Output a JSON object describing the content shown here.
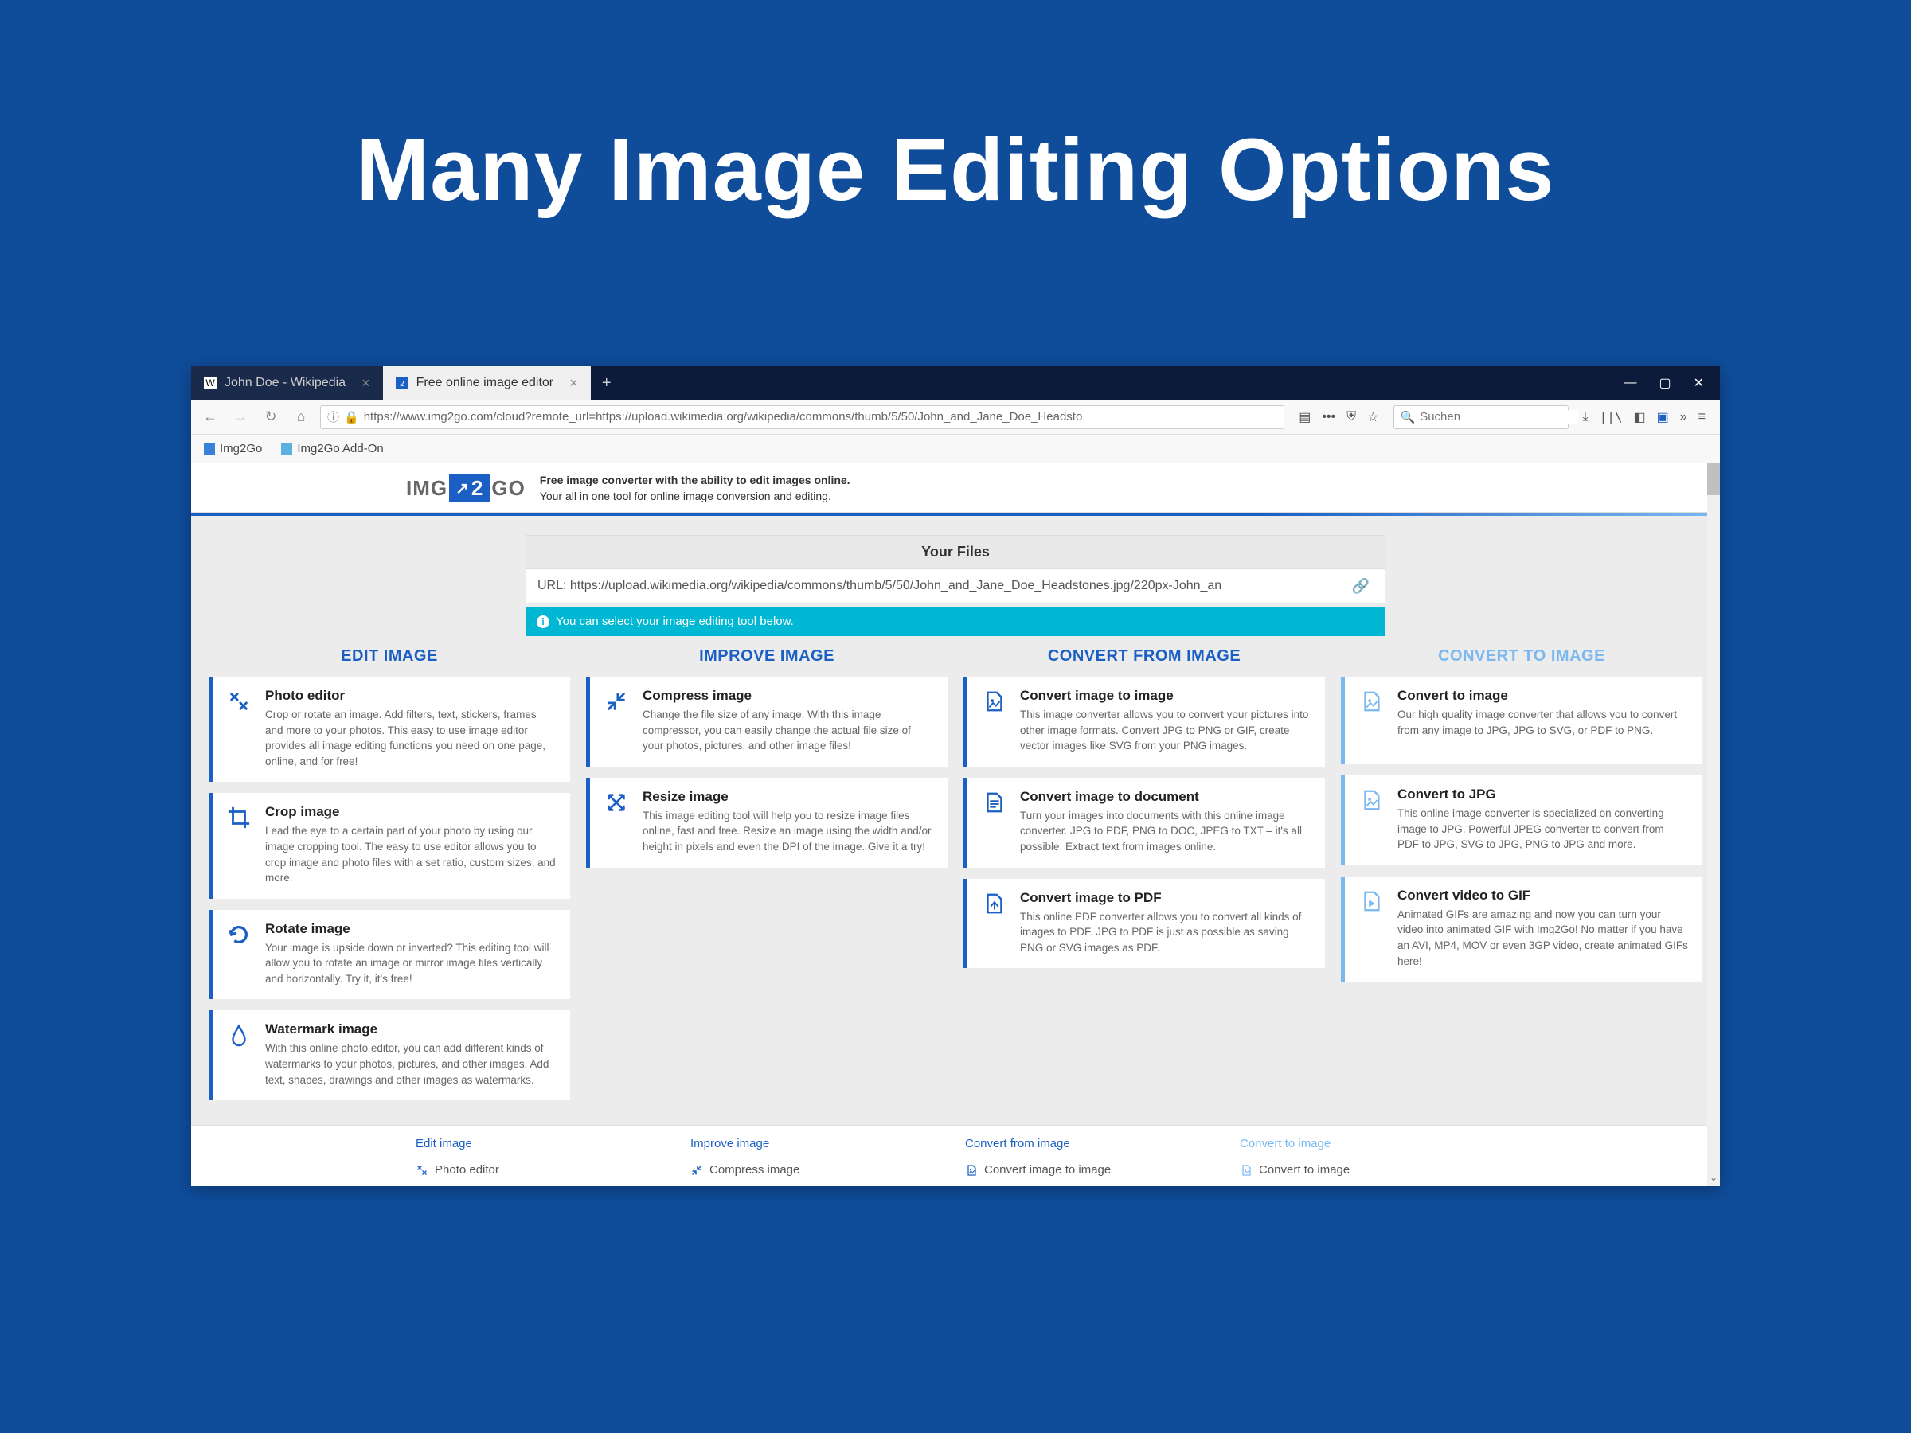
{
  "hero": {
    "title": "Many Image Editing Options"
  },
  "tabs": {
    "inactive": "John Doe - Wikipedia",
    "active": "Free online image editor"
  },
  "url": "https://www.img2go.com/cloud?remote_url=https://upload.wikimedia.org/wikipedia/commons/thumb/5/50/John_and_Jane_Doe_Headsto",
  "search_placeholder": "Suchen",
  "bookmarks": [
    "Img2Go",
    "Img2Go Add-On"
  ],
  "logo": {
    "left": "IMG",
    "mid": "2",
    "right": "GO"
  },
  "tagline": {
    "bold": "Free image converter with the ability to edit images online.",
    "sub": "Your all in one tool for online image conversion and editing."
  },
  "files": {
    "title": "Your Files",
    "url": "URL: https://upload.wikimedia.org/wikipedia/commons/thumb/5/50/John_and_Jane_Doe_Headstones.jpg/220px-John_an",
    "note": "You can select your image editing tool below."
  },
  "columns": [
    {
      "title": "EDIT IMAGE",
      "light": false,
      "cards": [
        {
          "icon": "design",
          "title": "Photo editor",
          "desc": "Crop or rotate an image. Add filters, text, stickers, frames and more to your photos. This easy to use image editor provides all image editing functions you need on one page, online, and for free!"
        },
        {
          "icon": "crop",
          "title": "Crop image",
          "desc": "Lead the eye to a certain part of your photo by using our image cropping tool. The easy to use editor allows you to crop image and photo files with a set ratio, custom sizes, and more."
        },
        {
          "icon": "rotate",
          "title": "Rotate image",
          "desc": "Your image is upside down or inverted? This editing tool will allow you to rotate an image or mirror image files vertically and horizontally. Try it, it's free!"
        },
        {
          "icon": "water",
          "title": "Watermark image",
          "desc": "With this online photo editor, you can add different kinds of watermarks to your photos, pictures, and other images. Add text, shapes, drawings and other images as watermarks."
        }
      ]
    },
    {
      "title": "IMPROVE IMAGE",
      "light": false,
      "cards": [
        {
          "icon": "compress",
          "title": "Compress image",
          "desc": "Change the file size of any image. With this image compressor, you can easily change the actual file size of your photos, pictures, and other image files!"
        },
        {
          "icon": "resize",
          "title": "Resize image",
          "desc": "This image editing tool will help you to resize image files online, fast and free. Resize an image using the width and/or height in pixels and even the DPI of the image. Give it a try!"
        }
      ]
    },
    {
      "title": "CONVERT FROM IMAGE",
      "light": false,
      "cards": [
        {
          "icon": "doc-img",
          "title": "Convert image to image",
          "desc": "This image converter allows you to convert your pictures into other image formats. Convert JPG to PNG or GIF, create vector images like SVG from your PNG images."
        },
        {
          "icon": "doc",
          "title": "Convert image to document",
          "desc": "Turn your images into documents with this online image converter. JPG to PDF, PNG to DOC, JPEG to TXT – it's all possible. Extract text from images online."
        },
        {
          "icon": "doc-pdf",
          "title": "Convert image to PDF",
          "desc": "This online PDF converter allows you to convert all kinds of images to PDF. JPG to PDF is just as possible as saving PNG or SVG images as PDF."
        }
      ]
    },
    {
      "title": "CONVERT TO IMAGE",
      "light": true,
      "cards": [
        {
          "icon": "doc-img",
          "title": "Convert to image",
          "desc": "Our high quality image converter that allows you to convert from any image to JPG, JPG to SVG, or PDF to PNG."
        },
        {
          "icon": "doc-img",
          "title": "Convert to JPG",
          "desc": "This online image converter is specialized on converting image to JPG. Powerful JPEG converter to convert from PDF to JPG, SVG to JPG, PNG to JPG and more."
        },
        {
          "icon": "video",
          "title": "Convert video to GIF",
          "desc": "Animated GIFs are amazing and now you can turn your video into animated GIF with Img2Go! No matter if you have an AVI, MP4, MOV or even 3GP video, create animated GIFs here!"
        }
      ]
    }
  ],
  "footer": {
    "cols": [
      {
        "title": "Edit image",
        "light": false,
        "icon": "design",
        "item": "Photo editor"
      },
      {
        "title": "Improve image",
        "light": false,
        "icon": "compress",
        "item": "Compress image"
      },
      {
        "title": "Convert from image",
        "light": false,
        "icon": "doc-img",
        "item": "Convert image to image"
      },
      {
        "title": "Convert to image",
        "light": true,
        "icon": "doc-img",
        "item": "Convert to image"
      }
    ]
  }
}
